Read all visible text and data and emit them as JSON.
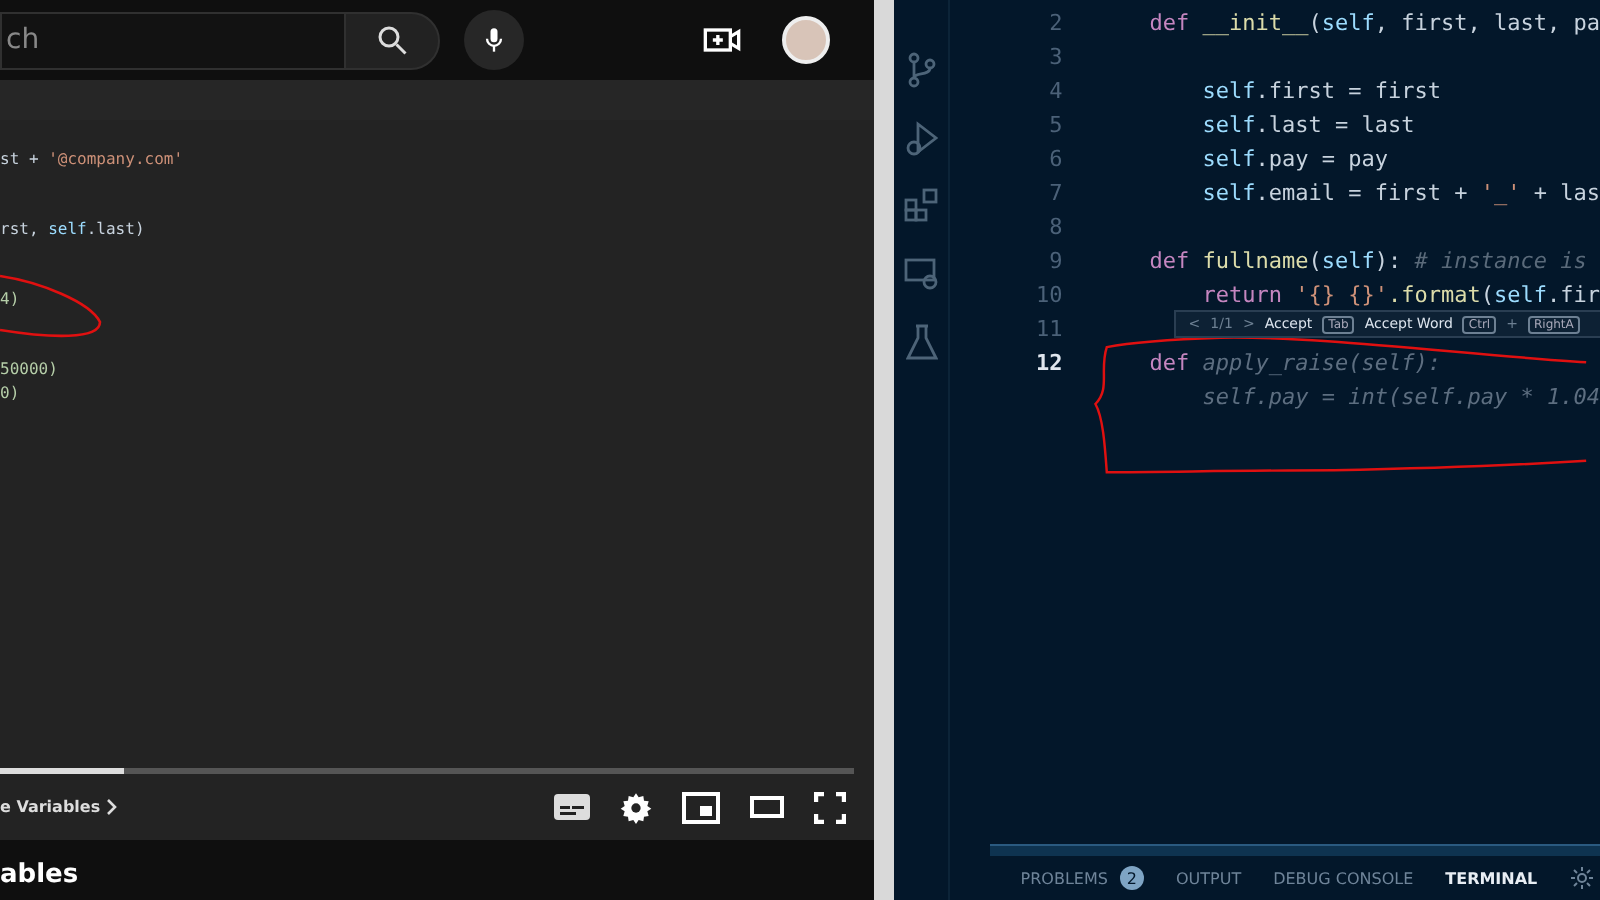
{
  "video": {
    "search": {
      "placeholder": "ch"
    },
    "code_lines": [
      {
        "tokens": [
          {
            "text": "st + ",
            "kind": "plain"
          },
          {
            "text": "'@company.com'",
            "kind": "string"
          }
        ]
      },
      {
        "tokens": [
          {
            "text": "rst, ",
            "kind": "plain"
          },
          {
            "text": "self",
            "kind": "self"
          },
          {
            "text": ".last)",
            "kind": "plain"
          }
        ]
      },
      {
        "tokens": [
          {
            "text": "4)",
            "kind": "number"
          }
        ]
      },
      {
        "tokens": [
          {
            "text": "50000)",
            "kind": "number"
          }
        ]
      },
      {
        "tokens": [
          {
            "text": "0)",
            "kind": "number"
          }
        ]
      }
    ],
    "progress": {
      "level": 0.145
    },
    "chapter": "e Variables",
    "title": "ables"
  },
  "editor": {
    "lines": [
      {
        "number": "2",
        "current": false,
        "tokens": [
          {
            "text": "    def ",
            "kind": "keyword"
          },
          {
            "text": "__init__",
            "kind": "func"
          },
          {
            "text": "(",
            "kind": "plain"
          },
          {
            "text": "self",
            "kind": "self"
          },
          {
            "text": ", first, last, pa",
            "kind": "plain"
          }
        ]
      },
      {
        "number": "3",
        "current": false
      },
      {
        "number": "4",
        "current": false,
        "tokens": [
          {
            "text": "        self",
            "kind": "self"
          },
          {
            "text": ".first = first",
            "kind": "plain"
          }
        ]
      },
      {
        "number": "5",
        "current": false,
        "tokens": [
          {
            "text": "        self",
            "kind": "self"
          },
          {
            "text": ".last = last",
            "kind": "plain"
          }
        ]
      },
      {
        "number": "6",
        "current": false,
        "tokens": [
          {
            "text": "        self",
            "kind": "self"
          },
          {
            "text": ".pay = pay",
            "kind": "plain"
          }
        ]
      },
      {
        "number": "7",
        "current": false,
        "tokens": [
          {
            "text": "        self",
            "kind": "self"
          },
          {
            "text": ".email = first + ",
            "kind": "plain"
          },
          {
            "text": "'_'",
            "kind": "string"
          },
          {
            "text": " + las",
            "kind": "plain"
          }
        ]
      },
      {
        "number": "8",
        "current": false
      },
      {
        "number": "9",
        "current": false,
        "tokens": [
          {
            "text": "    def ",
            "kind": "keyword"
          },
          {
            "text": "fullname",
            "kind": "func"
          },
          {
            "text": "(",
            "kind": "plain"
          },
          {
            "text": "self",
            "kind": "self"
          },
          {
            "text": "): ",
            "kind": "plain"
          },
          {
            "text": "# instance is",
            "kind": "comment"
          }
        ]
      },
      {
        "number": "10",
        "current": false,
        "tokens": [
          {
            "text": "        return ",
            "kind": "keyword"
          },
          {
            "text": "'{} {}'",
            "kind": "string"
          },
          {
            "text": ".format",
            "kind": "func"
          },
          {
            "text": "(",
            "kind": "plain"
          },
          {
            "text": "self",
            "kind": "self"
          },
          {
            "text": ".fir",
            "kind": "plain"
          }
        ]
      },
      {
        "number": "11",
        "current": false
      },
      {
        "number": "12",
        "current": true,
        "tokens": [
          {
            "text": "    def",
            "kind": "keyword"
          },
          {
            "text": " apply_raise(self):",
            "kind": "ghost"
          }
        ]
      },
      {
        "tokens": [
          {
            "text": "        self.pay = int(self.pay * 1.04",
            "kind": "ghost"
          }
        ]
      }
    ],
    "suggestion": {
      "prev": "<",
      "count": "1/1",
      "next": ">",
      "accept": "Accept",
      "accept_key": "Tab",
      "accept_word": "Accept Word",
      "word_key": "Ctrl",
      "plus": "+",
      "word_key_2": "RightA"
    },
    "panel_tabs": [
      {
        "label": "PROBLEMS",
        "badge": "2",
        "selected": false
      },
      {
        "label": "OUTPUT",
        "selected": false
      },
      {
        "label": "DEBUG CONSOLE",
        "selected": false
      },
      {
        "label": "TERMINAL",
        "selected": true
      }
    ]
  }
}
